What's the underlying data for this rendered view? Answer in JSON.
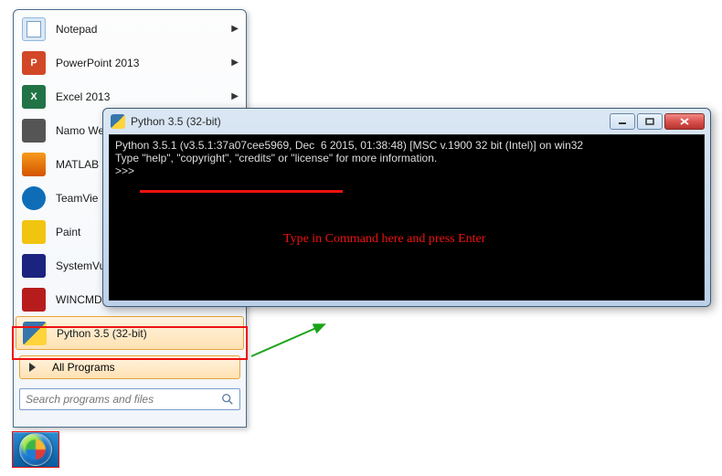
{
  "start_menu": {
    "items": [
      {
        "label": "Notepad",
        "has_submenu": true
      },
      {
        "label": "PowerPoint 2013",
        "has_submenu": true,
        "badge": "P",
        "color": "#d24726"
      },
      {
        "label": "Excel 2013",
        "has_submenu": true,
        "badge": "X",
        "color": "#217346"
      },
      {
        "label": "Namo We"
      },
      {
        "label": "MATLAB"
      },
      {
        "label": "TeamVie"
      },
      {
        "label": "Paint"
      },
      {
        "label": "SystemVu"
      },
      {
        "label": "WINCMD32 - Shortcut"
      },
      {
        "label": "Python 3.5 (32-bit)",
        "selected": true
      }
    ],
    "all_programs": "All Programs",
    "search_placeholder": "Search programs and files"
  },
  "console": {
    "title": "Python 3.5 (32-bit)",
    "lines": [
      "Python 3.5.1 (v3.5.1:37a07cee5969, Dec  6 2015, 01:38:48) [MSC v.1900 32 bit (Intel)] on win32",
      "Type \"help\", \"copyright\", \"credits\" or \"license\" for more information.",
      ">>>"
    ]
  },
  "annotation": {
    "text": "Type in Command here and press Enter"
  },
  "colors": {
    "highlight": "#e11",
    "arrow": "#1aa41a"
  }
}
